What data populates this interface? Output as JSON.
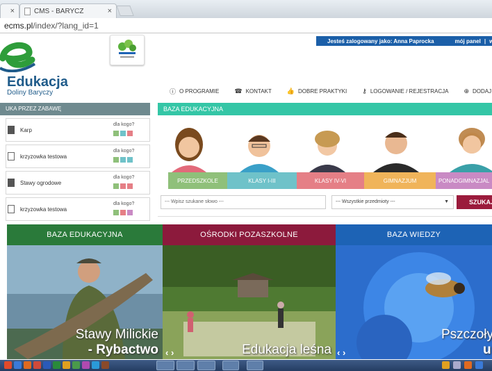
{
  "browser": {
    "tab_title": "CMS - BARYCZ",
    "url_host": "ecms.pl",
    "url_path": "/index/?lang_id=1"
  },
  "logo": {
    "title": "Edukacja",
    "subtitle": "Doliny Baryczy"
  },
  "userbar": {
    "logged_as": "Jesteś zalogowany jako: Anna Paprocka",
    "panel": "mój panel",
    "sep": "|",
    "logout": "wylog"
  },
  "nav": [
    {
      "label": "O PROGRAMIE",
      "icon": "info-icon"
    },
    {
      "label": "KONTAKT",
      "icon": "phone-icon"
    },
    {
      "label": "DOBRE PRAKTYKI",
      "icon": "thumbs-up-icon"
    },
    {
      "label": "LOGOWANIE / REJESTRACJA",
      "icon": "key-icon"
    },
    {
      "label": "DODAJ ZASÓ",
      "icon": "plus-icon"
    }
  ],
  "left": {
    "heading": "UKA PRZEZ ZABAWĘ",
    "cards": [
      {
        "title": "Karp",
        "who": "dla kogo?"
      },
      {
        "title": "krzyzowka testowa",
        "who": "dla kogo?"
      },
      {
        "title": "Stawy ogrodowe",
        "who": "dla kogo?"
      },
      {
        "title": "krzyzowka testowa",
        "who": "dla kogo?"
      }
    ]
  },
  "center": {
    "heading": "BAZA EDUKACYJNA",
    "tabs": [
      {
        "label": "PRZEDSZKOLE",
        "color": "#8fc07a"
      },
      {
        "label": "KLASY I-III",
        "color": "#6fc2c9"
      },
      {
        "label": "KLASY IV-VI",
        "color": "#e57f86"
      },
      {
        "label": "GIMNAZJUM",
        "color": "#f0b45a"
      },
      {
        "label": "PONADGIMNAZJAL",
        "color": "#c98ac4"
      }
    ],
    "search_placeholder": "--- Wpisz szukane słowo ---",
    "subject_select": "--- Wszystkie przedmioty ---",
    "search_button": "SZUKAJ"
  },
  "panels": [
    {
      "heading": "BAZA EDUKACYJNA",
      "color": "#2a7a3a",
      "cap1": "Stawy Milickie",
      "cap2": "- Rybactwo"
    },
    {
      "heading": "OŚRODKI POZASZKOLNE",
      "color": "#8c1a3c",
      "cap1": "Edukacja leśna",
      "cap2": ""
    },
    {
      "heading": "BAZA WIEDZY",
      "color": "#1d63b5",
      "cap1": "Pszczoły",
      "cap2": "u"
    }
  ],
  "arrows": "‹ ›"
}
